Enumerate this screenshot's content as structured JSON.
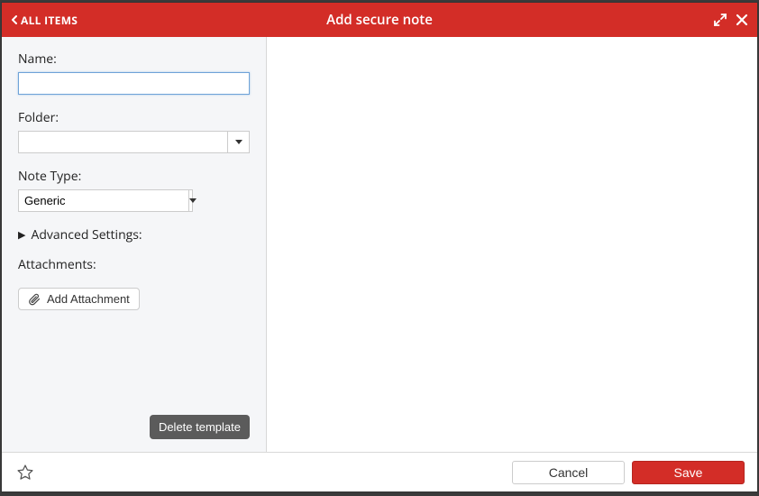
{
  "colors": {
    "accent": "#d32d27"
  },
  "header": {
    "back_label": "ALL ITEMS",
    "title": "Add secure note"
  },
  "form": {
    "name_label": "Name:",
    "name_value": "",
    "folder_label": "Folder:",
    "folder_value": "",
    "note_type_label": "Note Type:",
    "note_type_value": "Generic",
    "advanced_label": "Advanced Settings:",
    "attachments_label": "Attachments:",
    "add_attachment_label": "Add Attachment",
    "delete_template_label": "Delete template"
  },
  "footer": {
    "cancel_label": "Cancel",
    "save_label": "Save"
  }
}
